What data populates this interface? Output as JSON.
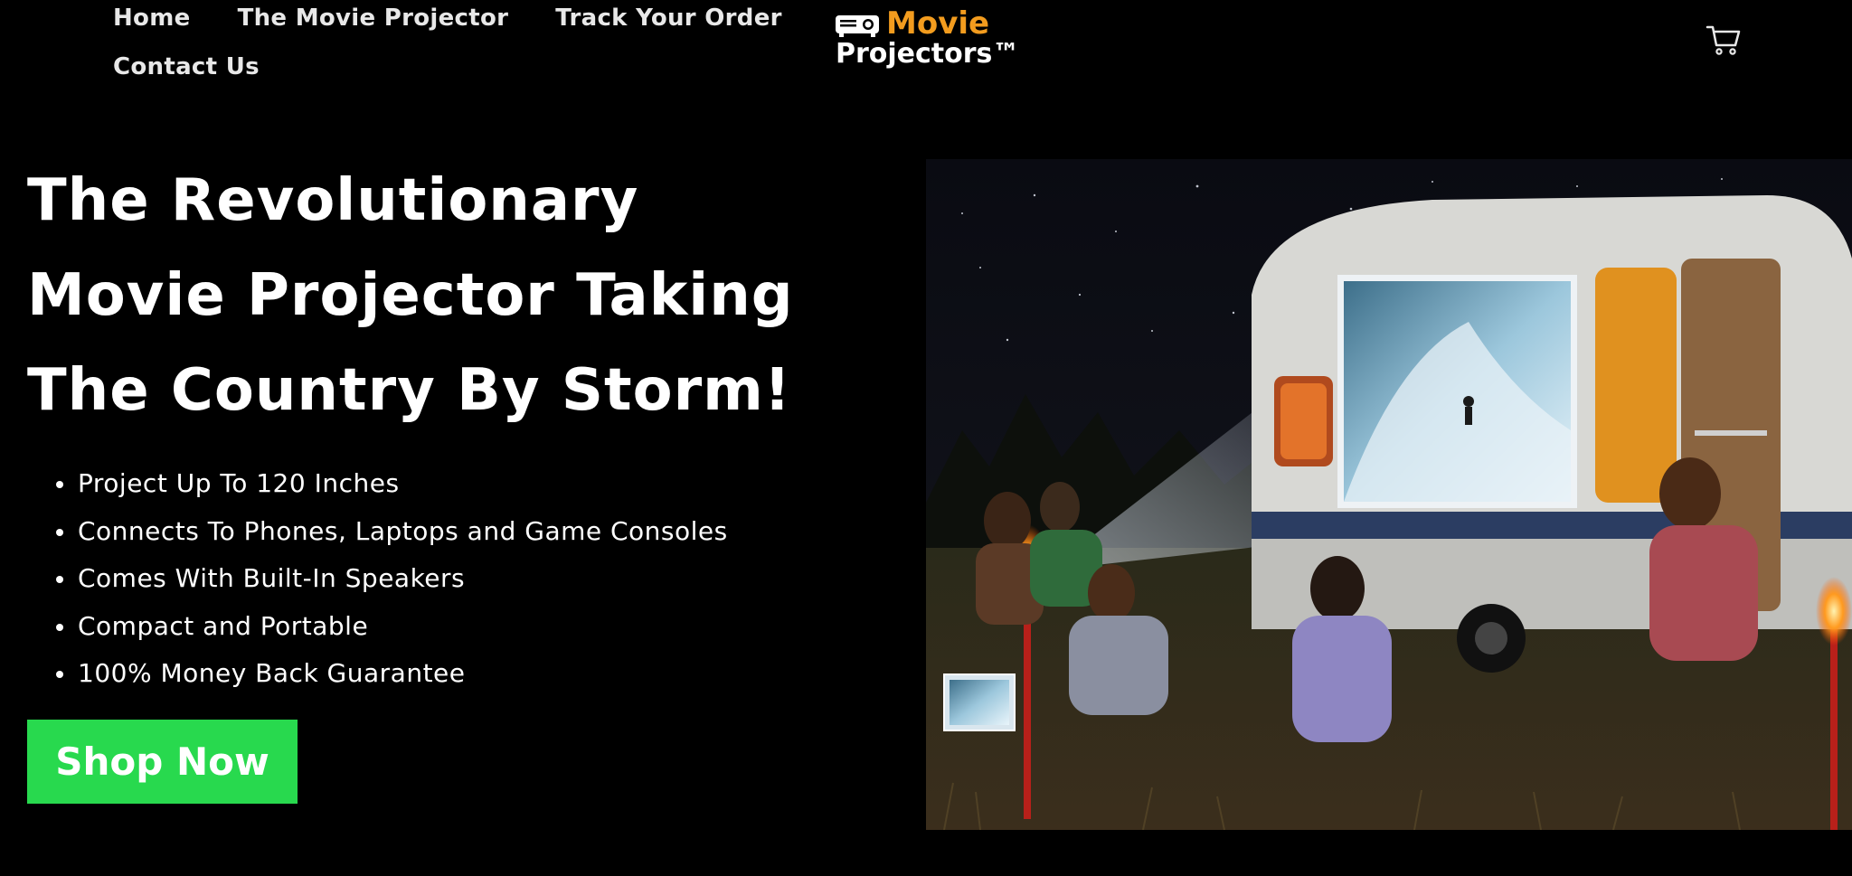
{
  "nav": {
    "items": [
      {
        "label": "Home"
      },
      {
        "label": "The Movie Projector"
      },
      {
        "label": "Track Your Order"
      },
      {
        "label": "Contact Us"
      }
    ]
  },
  "logo": {
    "line1": "Movie",
    "line2": "Projectors™",
    "line1_color": "#f39c1e",
    "icon": "projector-icon"
  },
  "cart": {
    "icon": "cart-icon"
  },
  "hero": {
    "title": "The Revolutionary Movie Projector Taking The Country By Storm!",
    "features": [
      "Project Up To 120 Inches",
      "Connects To Phones, Laptops and Game Consoles",
      "Comes With Built-In Speakers",
      "Compact and Portable",
      "100% Money Back Guarantee"
    ],
    "cta_label": "Shop Now",
    "cta_color": "#28d94e"
  },
  "colors": {
    "background": "#000000",
    "text": "#ffffff",
    "accent_orange": "#f39c1e",
    "accent_green": "#28d94e"
  }
}
